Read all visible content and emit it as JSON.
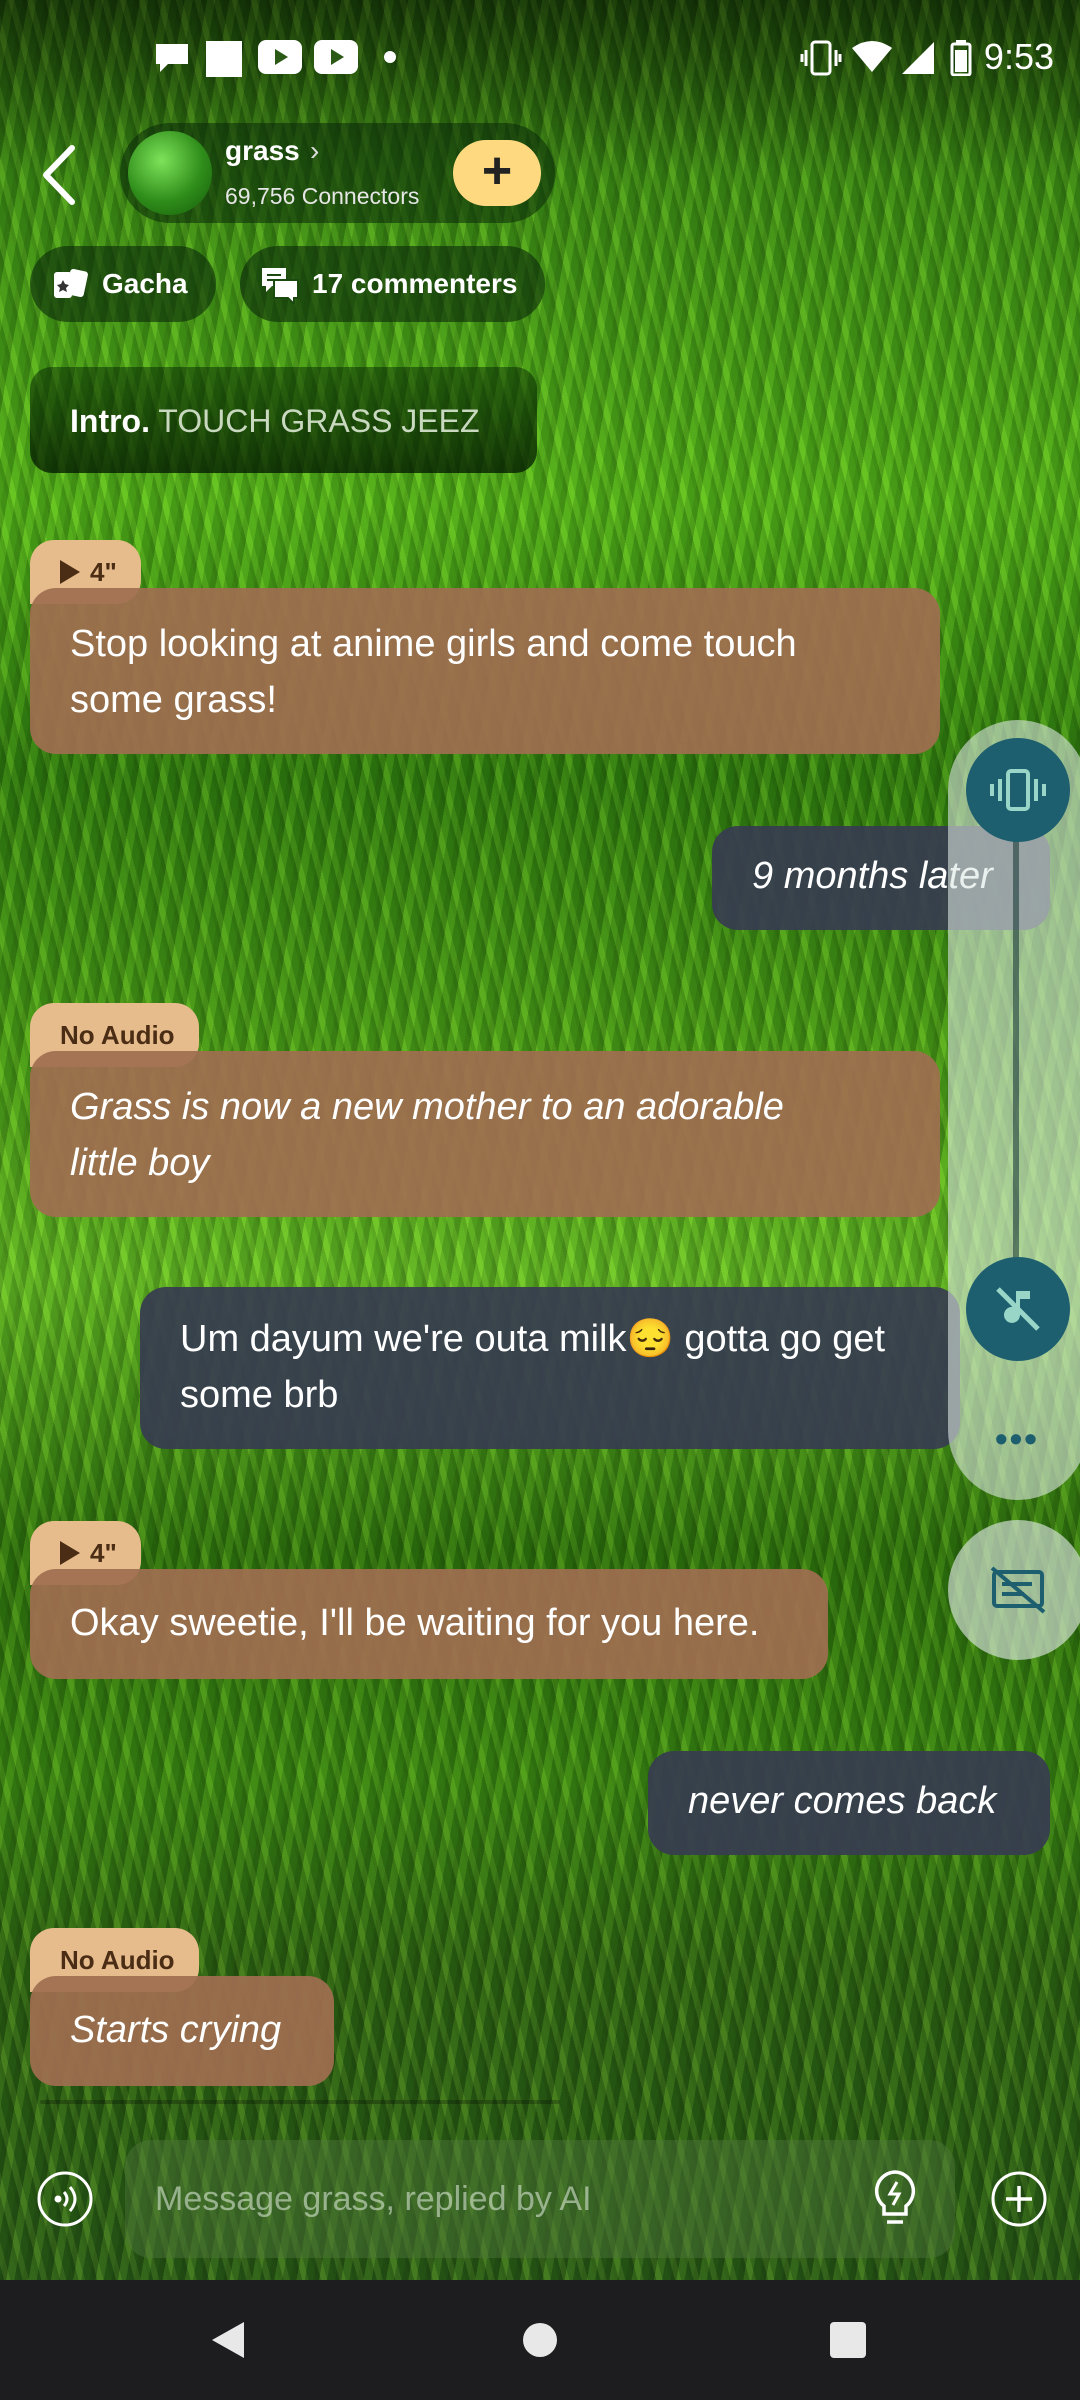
{
  "status_bar": {
    "time": "9:53",
    "icons": [
      "chat-bubble-icon",
      "square-icon",
      "youtube-icon",
      "youtube-icon",
      "dot-icon",
      "vibrate-icon",
      "wifi-icon",
      "signal-icon",
      "battery-icon"
    ]
  },
  "header": {
    "channel_name": "grass",
    "connectors": "69,756 Connectors",
    "follow_button": "+"
  },
  "chips": {
    "gacha": "Gacha",
    "commenters": "17 commenters"
  },
  "intro": {
    "label": "Intro.",
    "text": "TOUCH GRASS JEEZ"
  },
  "messages": [
    {
      "sender": "ai",
      "tag": "4\"",
      "line1": "Stop looking at anime girls and come touch",
      "line2": "some grass!"
    },
    {
      "sender": "user",
      "line1": "9 months later"
    },
    {
      "sender": "ai",
      "tag": "No Audio",
      "line1": "Grass is now a new mother to an adorable",
      "line2": "little boy"
    },
    {
      "sender": "user",
      "line1": "Um dayum we're outa milk😔 gotta go get",
      "line2": "some brb"
    },
    {
      "sender": "ai",
      "tag": "4\"",
      "line1": "Okay sweetie, I'll be waiting for you here."
    },
    {
      "sender": "user",
      "line1": "never comes back"
    },
    {
      "sender": "ai",
      "tag": "No Audio",
      "line1": "Starts crying"
    }
  ],
  "side_controls": {
    "more": "•••"
  },
  "composer": {
    "placeholder": "Message grass, replied by AI"
  },
  "colors": {
    "ai_bubble": "#a06e50",
    "user_bubble": "#373c50",
    "tag": "#e7bc8c",
    "accent_yellow": "#ffd980",
    "side_button": "#1d5f6e"
  }
}
